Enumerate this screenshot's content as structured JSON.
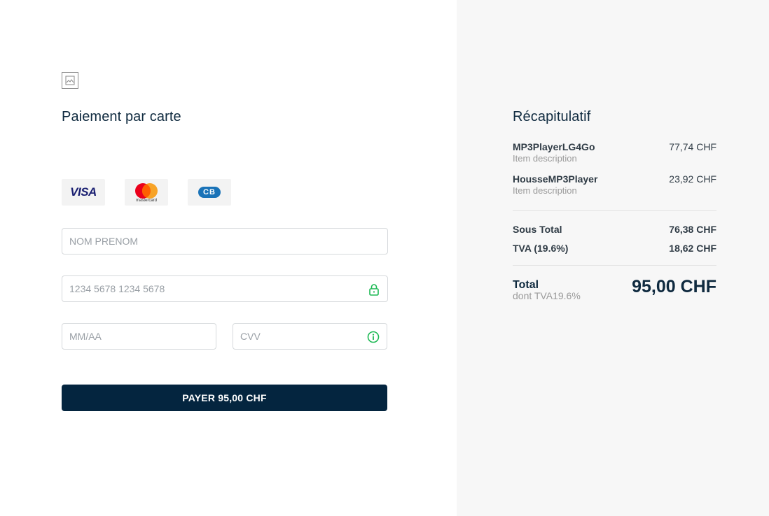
{
  "payment": {
    "title": "Paiement par carte",
    "logo_icon": "broken-image-icon",
    "card_brands": [
      "VISA",
      "mastercard",
      "CB"
    ],
    "fields": {
      "name_placeholder": "NOM PRENOM",
      "card_number_placeholder": "1234 5678 1234 5678",
      "expiry_placeholder": "MM/AA",
      "cvv_placeholder": "CVV"
    },
    "pay_button_label": "PAYER 95,00 CHF"
  },
  "summary": {
    "title": "Récapitulatif",
    "items": [
      {
        "name": "MP3PlayerLG4Go",
        "description": "Item description",
        "price": "77,74 CHF"
      },
      {
        "name": "HousseMP3Player",
        "description": "Item description",
        "price": "23,92 CHF"
      }
    ],
    "subtotal_label": "Sous Total",
    "subtotal_value": "76,38 CHF",
    "tax_label": "TVA (19.6%)",
    "tax_value": "18,62 CHF",
    "total_label": "Total",
    "total_sub": "dont TVA19.6%",
    "total_value": "95,00 CHF"
  },
  "colors": {
    "accent": "#04253f",
    "success_icon": "#1db954",
    "summary_bg": "#f7f7f7"
  }
}
